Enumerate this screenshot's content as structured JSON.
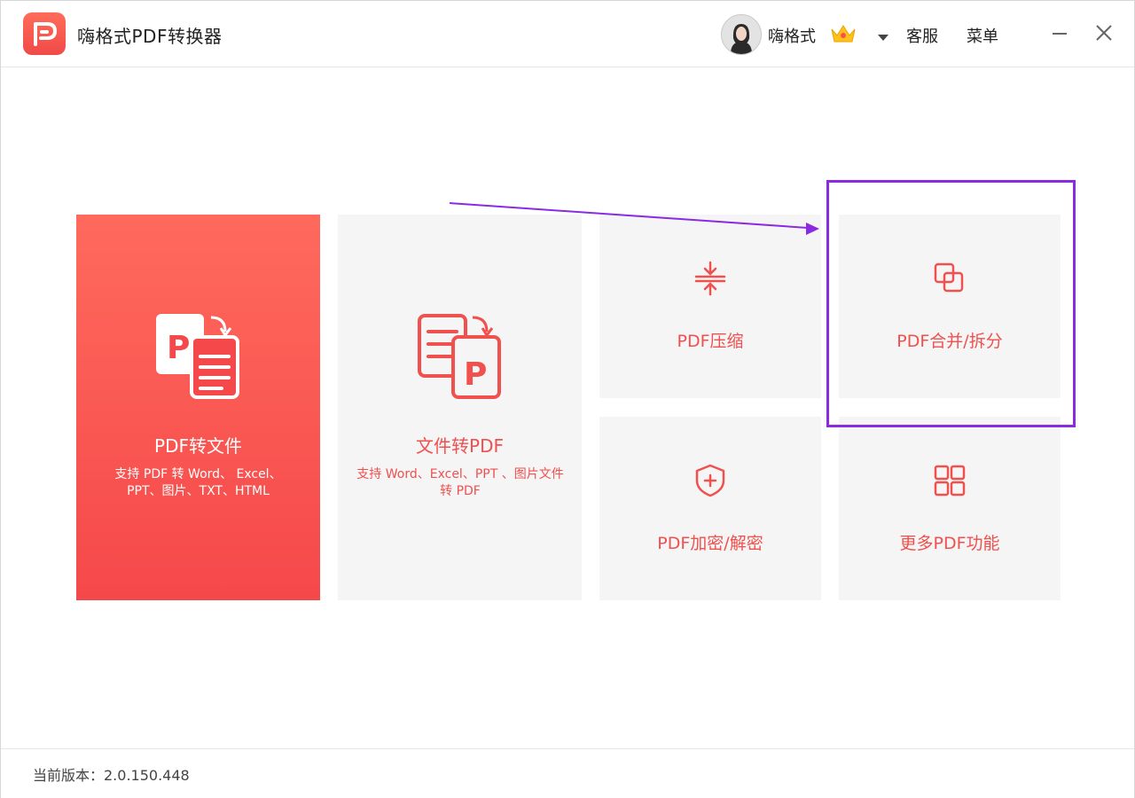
{
  "app": {
    "title": "嗨格式PDF转换器"
  },
  "header": {
    "username": "嗨格式",
    "service_label": "客服",
    "menu_label": "菜单"
  },
  "cards": {
    "pdf_to_file": {
      "title": "PDF转文件",
      "desc": "支持 PDF 转 Word、 Excel、PPT、图片、TXT、HTML"
    },
    "file_to_pdf": {
      "title": "文件转PDF",
      "desc": "支持 Word、Excel、PPT 、图片文件转 PDF"
    },
    "compress": {
      "title": "PDF压缩"
    },
    "merge_split": {
      "title": "PDF合并/拆分"
    },
    "encrypt": {
      "title": "PDF加密/解密"
    },
    "more": {
      "title": "更多PDF功能"
    }
  },
  "footer": {
    "version": "当前版本：2.0.150.448"
  },
  "colors": {
    "brand": "#f5484a",
    "card_bg": "#f5f5f5",
    "accent_text": "#f0504e",
    "highlight": "#8a2be2"
  },
  "icons": {
    "logo": "brand-logo-icon",
    "crown": "crown-icon",
    "dropdown": "caret-down-icon",
    "minimize": "minimize-icon",
    "close": "close-icon",
    "pdf_to_file": "pdf-to-document-icon",
    "file_to_pdf": "document-to-pdf-icon",
    "compress": "compress-icon",
    "merge_split": "merge-split-icon",
    "encrypt": "shield-plus-icon",
    "more": "grid-icon"
  }
}
